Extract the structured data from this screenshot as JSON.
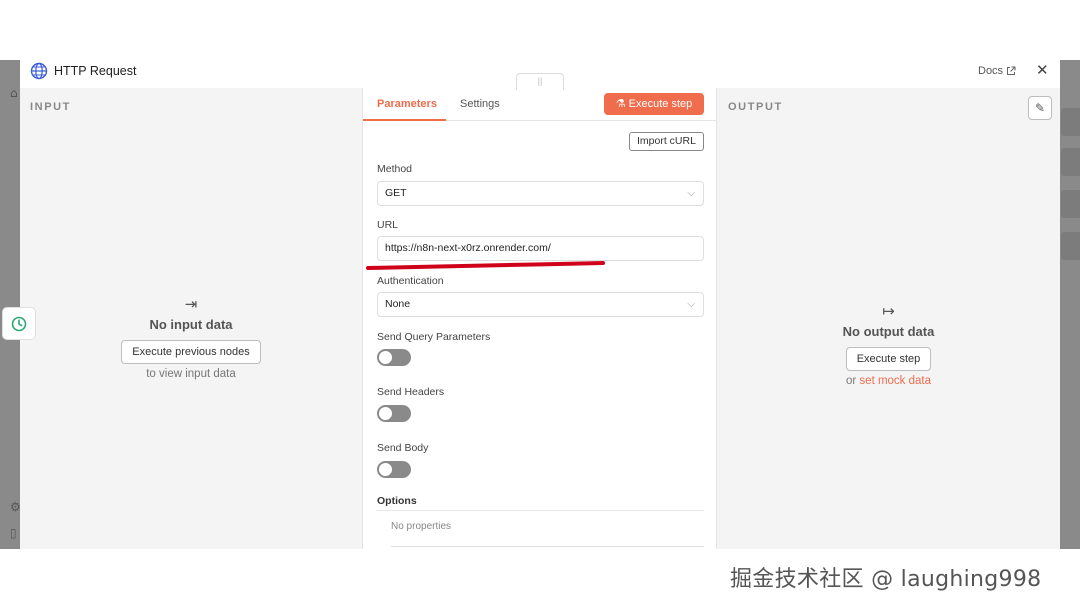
{
  "header": {
    "title": "HTTP Request",
    "docs_label": "Docs",
    "close_glyph": "✕",
    "drag_glyph": "||"
  },
  "input_panel": {
    "label": "INPUT",
    "arrow_glyph": "⇥",
    "empty_title": "No input data",
    "button_label": "Execute previous nodes",
    "hint": "to view input data"
  },
  "params_panel": {
    "tabs": [
      "Parameters",
      "Settings"
    ],
    "active_tab": "Parameters",
    "execute_label": "Execute step",
    "import_label": "Import cURL",
    "method": {
      "label": "Method",
      "value": "GET"
    },
    "url": {
      "label": "URL",
      "value": "https://n8n-next-x0rz.onrender.com/"
    },
    "authentication": {
      "label": "Authentication",
      "value": "None"
    },
    "toggles": [
      {
        "label": "Send Query Parameters",
        "on": false
      },
      {
        "label": "Send Headers",
        "on": false
      },
      {
        "label": "Send Body",
        "on": false
      }
    ],
    "options": {
      "label": "Options",
      "empty": "No properties"
    }
  },
  "output_panel": {
    "label": "OUTPUT",
    "arrow_glyph": "↦",
    "empty_title": "No output data",
    "button_label": "Execute step",
    "hint_prefix": "or",
    "hint_link": "set mock data"
  },
  "watermark": "掘金技术社区 @ laughing998",
  "colors": {
    "accent": "#ef6c4d",
    "annotation": "#d0021b",
    "panel_bg": "#f4f4f5",
    "backdrop": "#8a8a8a"
  },
  "icons": [
    "globe-icon",
    "external-link-icon",
    "close-icon",
    "flask-icon",
    "pencil-icon",
    "chevron-down-icon",
    "clock-icon",
    "arrow-to-right-icon"
  ]
}
